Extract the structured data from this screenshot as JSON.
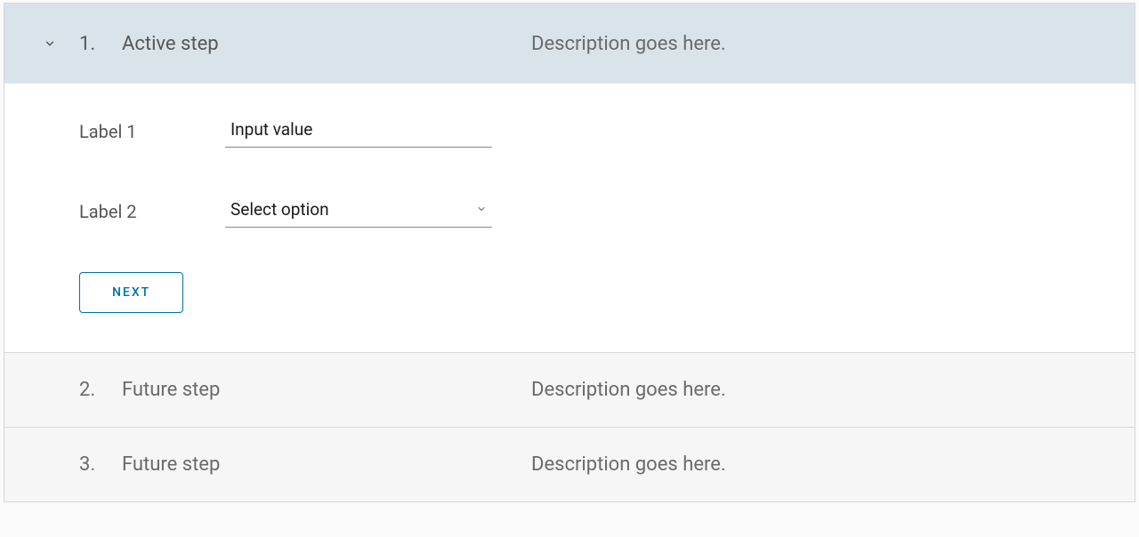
{
  "steps": [
    {
      "number": "1.",
      "title": "Active step",
      "description": "Description goes here."
    },
    {
      "number": "2.",
      "title": "Future step",
      "description": "Description goes here."
    },
    {
      "number": "3.",
      "title": "Future step",
      "description": "Description goes here."
    }
  ],
  "form": {
    "label1": "Label 1",
    "input1_value": "Input value",
    "label2": "Label 2",
    "select_value": "Select option",
    "next_button": "NEXT"
  }
}
